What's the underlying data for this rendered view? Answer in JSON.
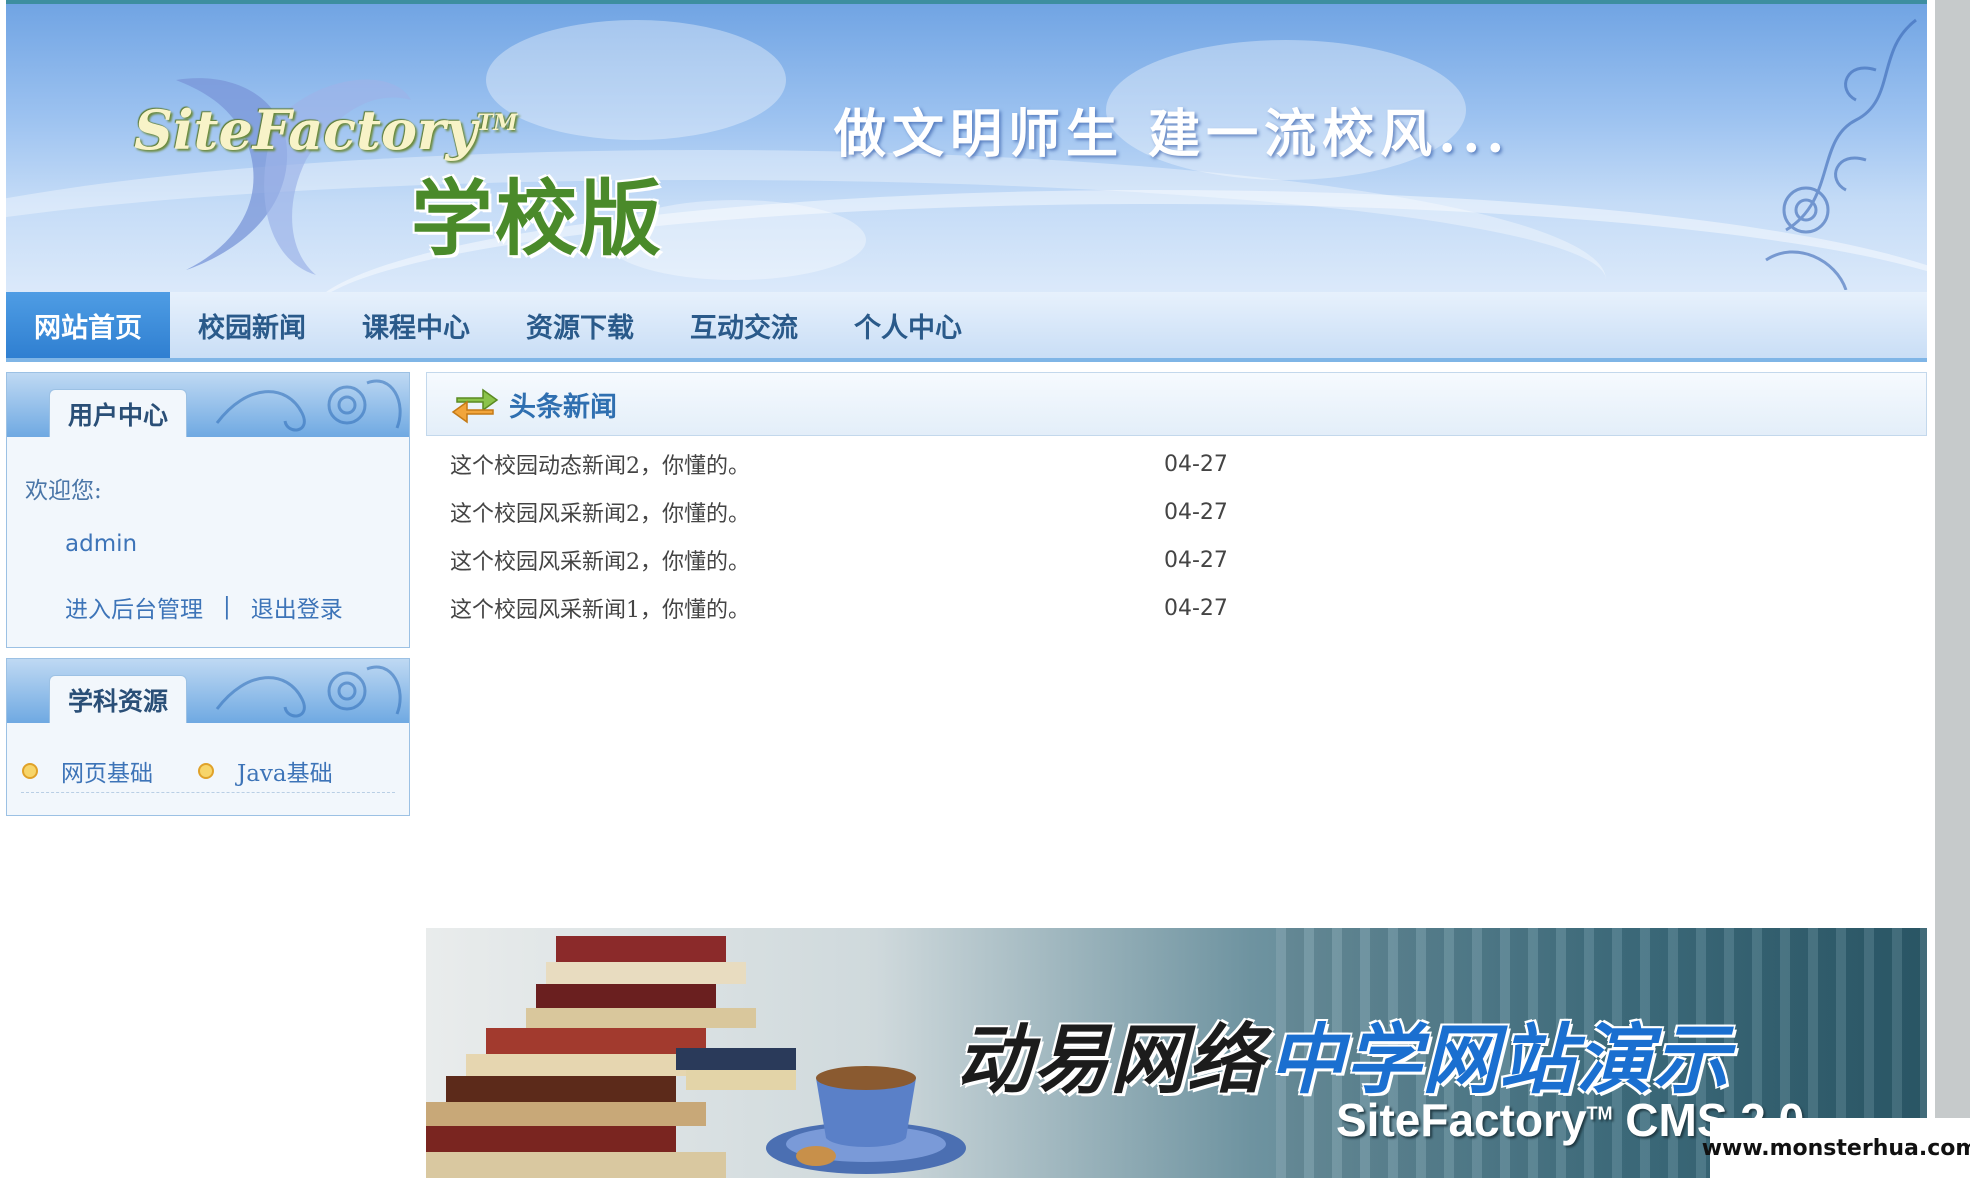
{
  "banner": {
    "brand_en": "SiteFactory",
    "brand_tm": "TM",
    "brand_cn": "学校版",
    "slogan": "做文明师生 建一流校风..."
  },
  "nav": {
    "items": [
      "网站首页",
      "校园新闻",
      "课程中心",
      "资源下载",
      "互动交流",
      "个人中心"
    ],
    "active_index": 0
  },
  "user_center": {
    "title": "用户中心",
    "welcome": "欢迎您:",
    "username": "admin",
    "admin_link": "进入后台管理",
    "separator": "|",
    "logout_link": "退出登录"
  },
  "subject_resources": {
    "title": "学科资源",
    "items": [
      "网页基础",
      "Java基础"
    ]
  },
  "headline_news": {
    "title": "头条新闻",
    "items": [
      {
        "title": "这个校园动态新闻2，你懂的。",
        "date": "04-27"
      },
      {
        "title": "这个校园风采新闻2，你懂的。",
        "date": "04-27"
      },
      {
        "title": "这个校园风采新闻2，你懂的。",
        "date": "04-27"
      },
      {
        "title": "这个校园风采新闻1，你懂的。",
        "date": "04-27"
      }
    ]
  },
  "promo": {
    "title_black": "动易网络",
    "title_blue": "中学网站演示",
    "subtitle": "SiteFactory",
    "subtitle_tm": "TM",
    "subtitle_rest": " CMS 2.0"
  },
  "watermark": "www.monsterhua.com",
  "colors": {
    "nav_active": "#2f7fd1",
    "link_blue": "#3d74b8",
    "heading_blue": "#2f6fb0"
  }
}
